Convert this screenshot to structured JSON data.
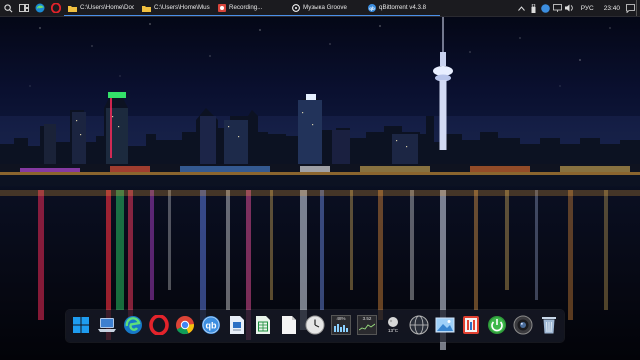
{
  "taskbar": {
    "tasks": [
      {
        "label": "C:\\Users\\Home\\Doc...",
        "icon": "folder-icon"
      },
      {
        "label": "C:\\Users\\Home\\Mus...",
        "icon": "folder-icon"
      },
      {
        "label": "Recording...",
        "icon": "recorder-icon"
      },
      {
        "label": "Музыка Groove",
        "icon": "groove-music-icon"
      },
      {
        "label": "qBittorrent v4.3.8",
        "icon": "qbittorrent-icon"
      }
    ],
    "tray": {
      "language": "РУС",
      "time": "23:40"
    }
  },
  "dock": {
    "items": [
      "windows-start-icon",
      "my-computer-icon",
      "edge-icon",
      "opera-icon",
      "chrome-icon",
      "qbittorrent-icon",
      "document-icon",
      "spreadsheet-icon",
      "blank-document-icon",
      "clock-widget-icon",
      "cpu-meter-widget-icon",
      "network-meter-widget-icon",
      "weather-widget-icon",
      "globe-icon",
      "photos-icon",
      "media-player-icon",
      "power-icon",
      "camera-icon",
      "recycle-bin-icon"
    ],
    "widgets": {
      "cpu_reading": "48%",
      "net_reading": "3.52",
      "weather_temp": "13°C"
    }
  },
  "colors": {
    "taskbar_bg": "#1b1b1f",
    "accent": "#4a8fe8"
  }
}
